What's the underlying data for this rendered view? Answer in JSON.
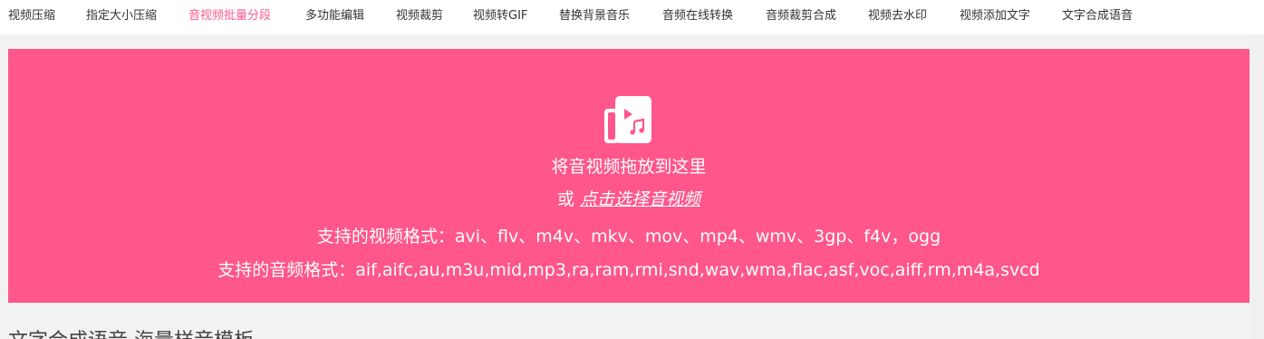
{
  "nav": {
    "items": [
      {
        "label": "视频压缩"
      },
      {
        "label": "指定大小压缩"
      },
      {
        "label": "音视频批量分段"
      },
      {
        "label": "多功能编辑"
      },
      {
        "label": "视频裁剪"
      },
      {
        "label": "视频转GIF"
      },
      {
        "label": "替换背景音乐"
      },
      {
        "label": "音频在线转换"
      },
      {
        "label": "音频裁剪合成"
      },
      {
        "label": "视频去水印"
      },
      {
        "label": "视频添加文字"
      },
      {
        "label": "文字合成语音"
      }
    ],
    "active_index": 2
  },
  "dropzone": {
    "icon": "video-music-file-icon",
    "title": "将音视频拖放到这里",
    "or_prefix": "或",
    "choose_link": "点击选择音视频",
    "video_formats": "支持的视频格式：avi、flv、m4v、mkv、mov、mp4、wmv、3gp、f4v，ogg",
    "audio_formats": "支持的音频格式：aif,aifc,au,m3u,mid,mp3,ra,ram,rmi,snd,wav,wma,flac,asf,voc,aiff,rm,m4a,svcd"
  },
  "section": {
    "heading": "文字合成语音 海量样音模板"
  },
  "colors": {
    "accent": "#ff568b",
    "active_nav": "#ff5a8c",
    "nav_bg": "#ffffff",
    "page_bg": "#f2f2f2"
  }
}
